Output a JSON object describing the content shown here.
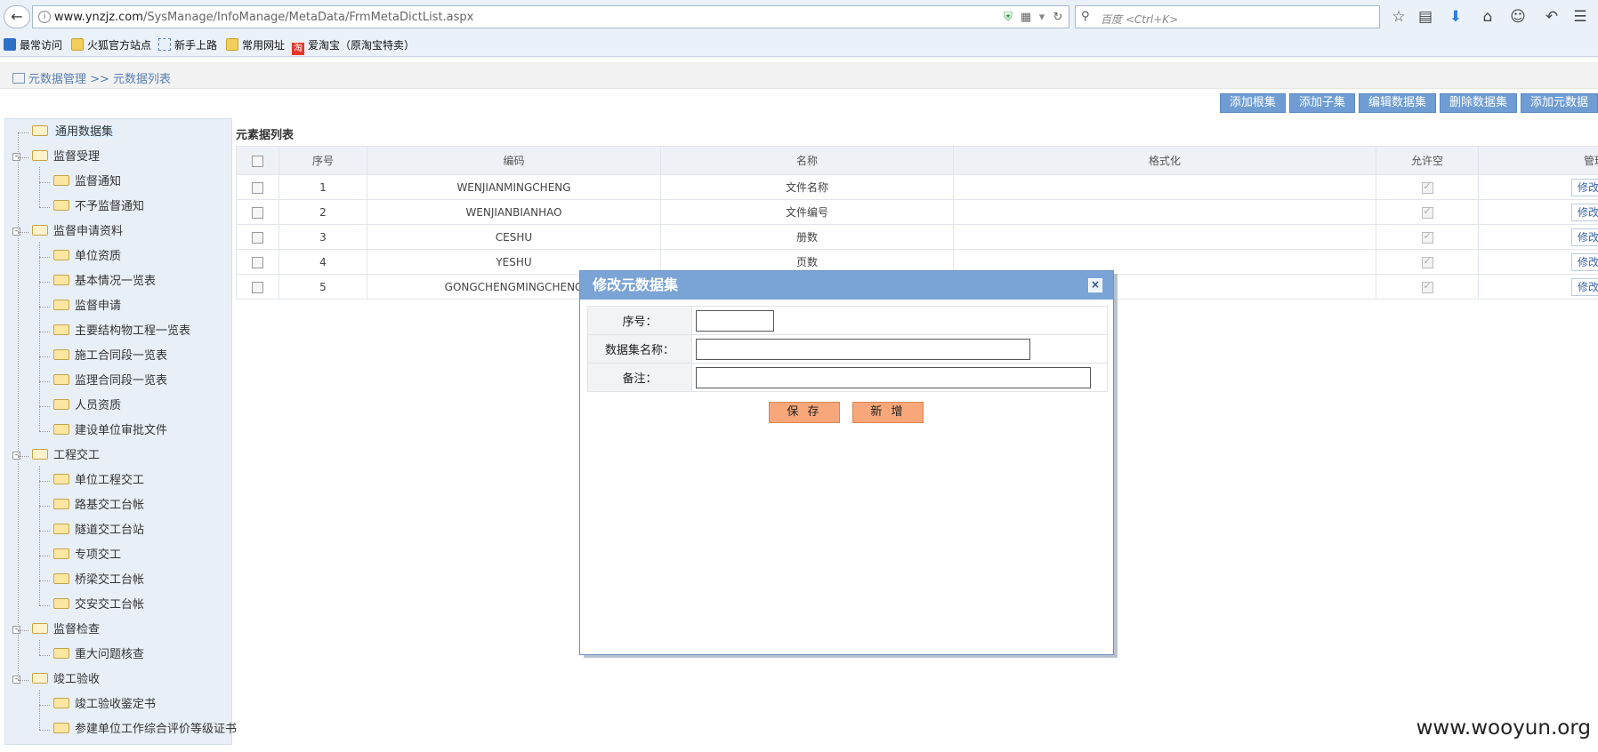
{
  "browser": {
    "url_host": "www.ynzjz.com",
    "url_path": "/SysManage/InfoManage/MetaData/FrmMetaDictList.aspx",
    "search_placeholder": "百度 <Ctrl+K>"
  },
  "bookmarks": [
    "最常访问",
    "火狐官方站点",
    "新手上路",
    "常用网址",
    "爱淘宝（原淘宝特卖）"
  ],
  "bookmark_tao_glyph": "淘",
  "breadcrumb": "元数据管理 >> 元数据列表",
  "actions": [
    "添加根集",
    "添加子集",
    "编辑数据集",
    "删除数据集",
    "添加元数据"
  ],
  "tree": [
    {
      "label": "通用数据集",
      "level": 0,
      "selected": true
    },
    {
      "label": "监督受理",
      "level": 0,
      "toggle": "-"
    },
    {
      "label": "监督通知",
      "level": 1
    },
    {
      "label": "不予监督通知",
      "level": 1
    },
    {
      "label": "监督申请资料",
      "level": 0,
      "toggle": "-"
    },
    {
      "label": "单位资质",
      "level": 1
    },
    {
      "label": "基本情况一览表",
      "level": 1
    },
    {
      "label": "监督申请",
      "level": 1
    },
    {
      "label": "主要结构物工程一览表",
      "level": 1
    },
    {
      "label": "施工合同段一览表",
      "level": 1
    },
    {
      "label": "监理合同段一览表",
      "level": 1
    },
    {
      "label": "人员资质",
      "level": 1
    },
    {
      "label": "建设单位审批文件",
      "level": 1
    },
    {
      "label": "工程交工",
      "level": 0,
      "toggle": "-"
    },
    {
      "label": "单位工程交工",
      "level": 1
    },
    {
      "label": "路基交工台帐",
      "level": 1
    },
    {
      "label": "隧道交工台站",
      "level": 1
    },
    {
      "label": "专项交工",
      "level": 1
    },
    {
      "label": "桥梁交工台帐",
      "level": 1
    },
    {
      "label": "交安交工台帐",
      "level": 1
    },
    {
      "label": "监督检查",
      "level": 0,
      "toggle": "-"
    },
    {
      "label": "重大问题核查",
      "level": 1
    },
    {
      "label": "竣工验收",
      "level": 0,
      "toggle": "-"
    },
    {
      "label": "竣工验收鉴定书",
      "level": 1
    },
    {
      "label": "参建单位工作综合评价等级证书",
      "level": 1
    }
  ],
  "list_title": "元素据列表",
  "table": {
    "headers": [
      "序号",
      "编码",
      "名称",
      "格式化",
      "允许空",
      "管理"
    ],
    "rows": [
      {
        "no": "1",
        "code": "WENJIANMINGCHENG",
        "name": "文件名称",
        "format": ""
      },
      {
        "no": "2",
        "code": "WENJIANBIANHAO",
        "name": "文件编号",
        "format": ""
      },
      {
        "no": "3",
        "code": "CESHU",
        "name": "册数",
        "format": ""
      },
      {
        "no": "4",
        "code": "YESHU",
        "name": "页数",
        "format": ""
      },
      {
        "no": "5",
        "code": "GONGCHENGMINGCHENG",
        "name": "",
        "format": ""
      }
    ],
    "edit_label": "修改"
  },
  "dialog": {
    "title": "修改元数据集",
    "close_glyph": "×",
    "fields": [
      {
        "label": "序号：",
        "value": ""
      },
      {
        "label": "数据集名称：",
        "value": ""
      },
      {
        "label": "备注：",
        "value": ""
      }
    ],
    "save_label": "保 存",
    "new_label": "新 增"
  },
  "watermark": "www.wooyun.org"
}
